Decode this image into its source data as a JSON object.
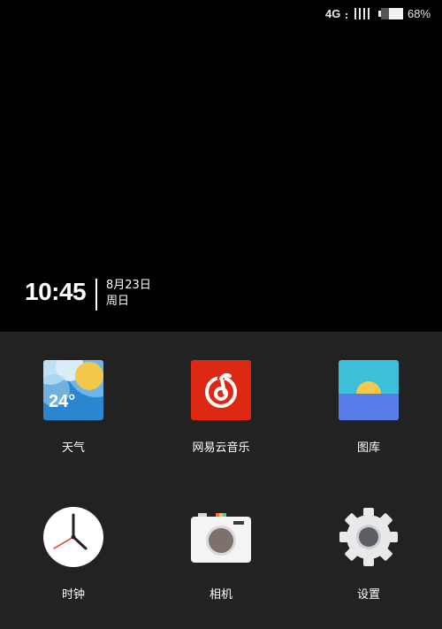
{
  "status_bar": {
    "network": "4G",
    "battery_text": "68%",
    "battery_level": 0.68
  },
  "clock": {
    "time": "10:45",
    "date": "8月23日",
    "weekday": "周日"
  },
  "apps": [
    {
      "label": "天气",
      "icon": "weather-icon",
      "temperature": "24°"
    },
    {
      "label": "网易云音乐",
      "icon": "netease-music-icon"
    },
    {
      "label": "图库",
      "icon": "gallery-icon"
    },
    {
      "label": "时钟",
      "icon": "clock-icon"
    },
    {
      "label": "相机",
      "icon": "camera-icon"
    },
    {
      "label": "设置",
      "icon": "settings-gear-icon"
    }
  ],
  "colors": {
    "wallpaper": "#000000",
    "drawer_background": "#222222",
    "music_red": "#dd2914",
    "gallery_sky": "#3ec0d8",
    "gallery_sea": "#5a7ce8",
    "sun_yellow": "#f2c94c"
  }
}
